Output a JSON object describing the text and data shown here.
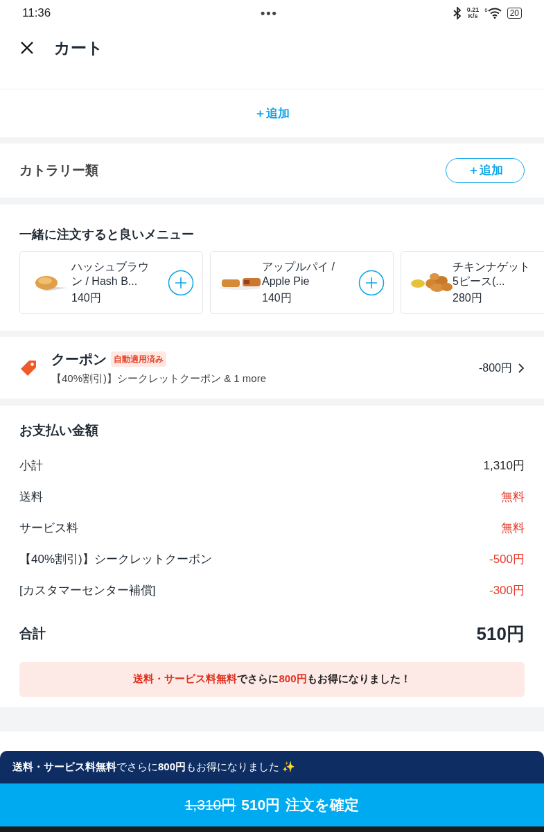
{
  "status_bar": {
    "time": "11:36",
    "dots": "•••",
    "speed_value": "0.21",
    "speed_unit": "K/s",
    "wifi_badge": "6",
    "battery": "20"
  },
  "header": {
    "title": "カート"
  },
  "add_row": {
    "label": "＋追加"
  },
  "cutlery": {
    "title": "カトラリー類",
    "button": "＋追加"
  },
  "recommend": {
    "title": "一緒に注文すると良いメニュー",
    "items": [
      {
        "name": "ハッシュブラウン / Hash B...",
        "price": "140円",
        "kind": "hashbrown"
      },
      {
        "name": "アップルパイ / Apple Pie",
        "price": "140円",
        "kind": "pie"
      },
      {
        "name": "チキンナゲット 5ピース(...",
        "price": "280円",
        "kind": "nugget"
      }
    ]
  },
  "coupon": {
    "title": "クーポン",
    "badge": "自動適用済み",
    "detail": "【40%割引)】シークレットクーポン  & 1 more",
    "amount": "-800円"
  },
  "payment": {
    "title": "お支払い金額",
    "lines": [
      {
        "label": "小計",
        "value": "1,310円",
        "highlight": false
      },
      {
        "label": "送料",
        "value": "無料",
        "highlight": true
      },
      {
        "label": "サービス料",
        "value": "無料",
        "highlight": true
      },
      {
        "label": "【40%割引)】シークレットクーポン",
        "value": "-500円",
        "highlight": true
      },
      {
        "label": "[カスタマーセンター補償]",
        "value": "-300円",
        "highlight": true
      }
    ],
    "total_label": "合計",
    "total_value": "510円",
    "savings": [
      {
        "text": "送料・サービス料無料",
        "highlight": true
      },
      {
        "text": "でさらに",
        "highlight": false
      },
      {
        "text": "800円",
        "highlight": true
      },
      {
        "text": "もお得になりました！",
        "highlight": false
      }
    ]
  },
  "bottom": {
    "notice": "**送料・サービス料無料**でさらに**800円**もお得になりました ✨",
    "old_price": "1,310円",
    "price": "510円",
    "action": "注文を確定"
  }
}
